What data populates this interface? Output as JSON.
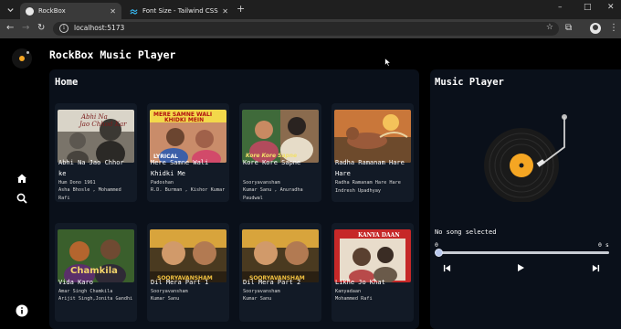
{
  "browser": {
    "tabs": [
      {
        "label": "RockBox",
        "active": true,
        "favicon_color": "#e8e8e8"
      },
      {
        "label": "Font Size - Tailwind CSS",
        "active": false,
        "favicon_color": "#38bdf8"
      }
    ],
    "new_tab_label": "+",
    "window_controls": {
      "minimize": "–",
      "maximize": "□",
      "close": "✕",
      "tab_close": "✕"
    },
    "nav": {
      "back": "←",
      "forward": "→",
      "reload": "↻"
    },
    "address": {
      "url": "localhost:5173",
      "info_icon": "i",
      "star": "☆"
    },
    "extensions_icon": "⧉",
    "menu_icon": "⋮"
  },
  "app": {
    "title": "RockBox Music Player",
    "sidebar": [
      {
        "name": "home-icon"
      },
      {
        "name": "search-icon"
      },
      {
        "name": "info-icon"
      }
    ],
    "home": {
      "title": "Home",
      "songs": [
        {
          "title": "Abhi Na Jao Chhor ke",
          "movie": "Hum Dono 1961",
          "artists": "Asha Bhosle , Mohammed Rafi",
          "art": "bw"
        },
        {
          "title": "Mere Samne Wali Khidki Me",
          "movie": "Padoshan",
          "artists": "R.D. Burman , Kishor Kumar",
          "art": "padosan",
          "caption": "LYRICAL"
        },
        {
          "title": "Kore Kore Sapne",
          "movie": "Sooryavansham",
          "artists": "Kumar Sanu , Anuradha Paudwal",
          "art": "kore"
        },
        {
          "title": "Radha Ramanam Hare Hare",
          "movie": "",
          "artists": "Radha Ramanam Hare Hare Indresh Upadhyay",
          "art": "radha"
        },
        {
          "title": "Vida Karo",
          "movie": "Amar Singh Chamkila",
          "artists": "Arijit Singh,Jonita Gandhi",
          "art": "chamkila"
        },
        {
          "title": "Dil Mera Part 1",
          "movie": "Sooryavansham",
          "artists": "Kumar Sanu",
          "art": "soory"
        },
        {
          "title": "Dil Mera Part 2",
          "movie": "Sooryavansham",
          "artists": "Kumar Sanu",
          "art": "soory"
        },
        {
          "title": "Likhe Jo Khat",
          "movie": "Kanyadaan",
          "artists": "Mohammed Rafi",
          "art": "kanya"
        }
      ]
    },
    "player": {
      "title": "Music Player",
      "status": "No song selected",
      "time_start": "0",
      "time_end": "0 s",
      "progress": 0
    }
  }
}
